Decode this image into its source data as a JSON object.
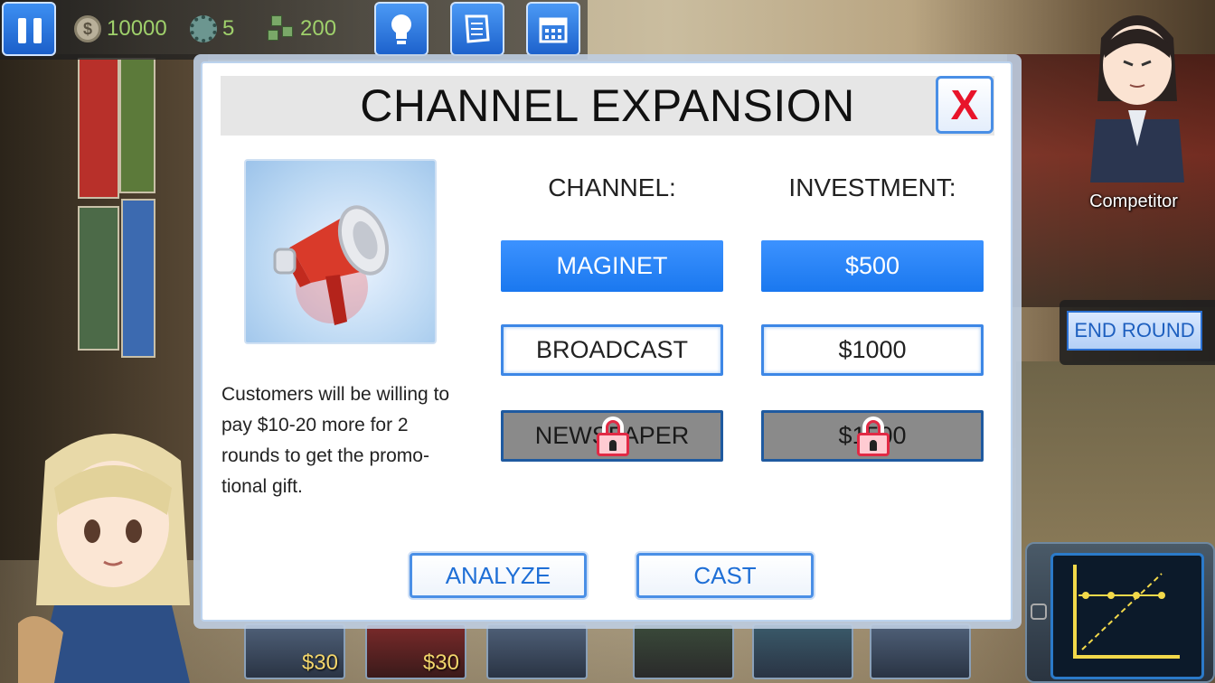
{
  "hud": {
    "coins": "10000",
    "gears": "5",
    "items": "200",
    "buttons": [
      "lightbulb-icon",
      "scroll-icon",
      "calendar-icon"
    ]
  },
  "competitor": {
    "label": "Competitor"
  },
  "end_round": {
    "label": "END ROUND"
  },
  "modal": {
    "title": "CHANNEL EXPANSION",
    "close_label": "X",
    "description": "Customers will be willing to pay $10-20 more for 2 rounds to get the promo-tional gift.",
    "channel_header": "CHANNEL:",
    "investment_header": "INVESTMENT:",
    "channels": [
      {
        "label": "MAGINET",
        "state": "selected"
      },
      {
        "label": "BROADCAST",
        "state": "normal"
      },
      {
        "label": "NEWSPAPER",
        "state": "locked"
      }
    ],
    "investments": [
      {
        "label": "$500",
        "state": "selected"
      },
      {
        "label": "$1000",
        "state": "normal"
      },
      {
        "label": "$1500",
        "state": "locked"
      }
    ],
    "analyze_label": "ANALYZE",
    "cast_label": "CAST"
  },
  "bottom_items": [
    {
      "price": "$30"
    },
    {
      "price": "$30"
    }
  ],
  "colors": {
    "accent": "#1a78ef",
    "close_x": "#e8142a",
    "hud_text": "#9fd06b"
  }
}
